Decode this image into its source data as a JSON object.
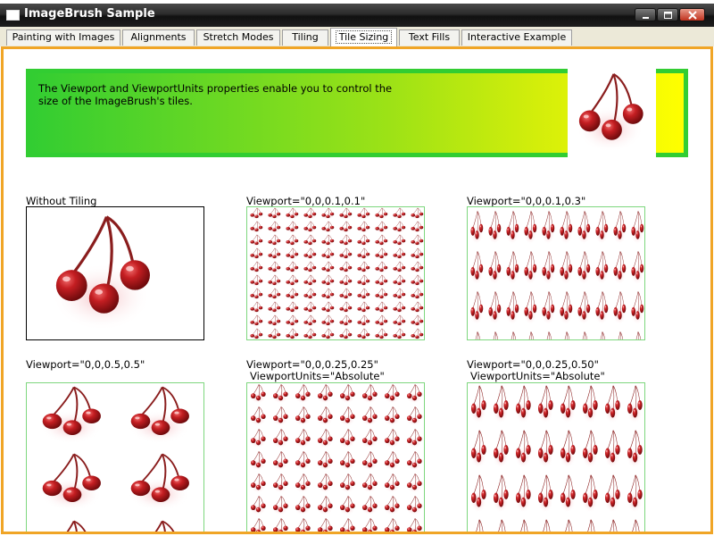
{
  "window": {
    "title": "ImageBrush Sample",
    "icon": "app-window-icon",
    "controls": [
      "minimize-icon",
      "maximize-icon",
      "close-icon"
    ]
  },
  "tabs": [
    {
      "label": "Painting with Images",
      "active": false
    },
    {
      "label": "Alignments",
      "active": false
    },
    {
      "label": "Stretch Modes",
      "active": false
    },
    {
      "label": "Tiling",
      "active": false
    },
    {
      "label": "Tile Sizing",
      "active": true
    },
    {
      "label": "Text Fills",
      "active": false
    },
    {
      "label": "Interactive Example",
      "active": false
    }
  ],
  "banner": {
    "text": "The Viewport and ViewportUnits properties enable you to control the size of the ImageBrush's tiles.",
    "image": "cherries-image"
  },
  "tiles": [
    {
      "label": "Without Tiling",
      "label2": ""
    },
    {
      "label": "Viewport=\"0,0,0.1,0.1\"",
      "label2": ""
    },
    {
      "label": "Viewport=\"0,0,0.1,0.3\"",
      "label2": ""
    },
    {
      "label": "Viewport=\"0,0,0.5,0.5\"",
      "label2": ""
    },
    {
      "label": "Viewport=\"0,0,0.25,0.25\"",
      "label2": "ViewportUnits=\"Absolute\""
    },
    {
      "label": "Viewport=\"0,0,0.25,0.50\"",
      "label2": "ViewportUnits=\"Absolute\""
    }
  ],
  "colors": {
    "accent_border": "#f0a526",
    "banner_border": "#32cd32",
    "gradient_start": "#32cd32",
    "gradient_end": "#ffff00",
    "cherry": "#b3161c"
  }
}
